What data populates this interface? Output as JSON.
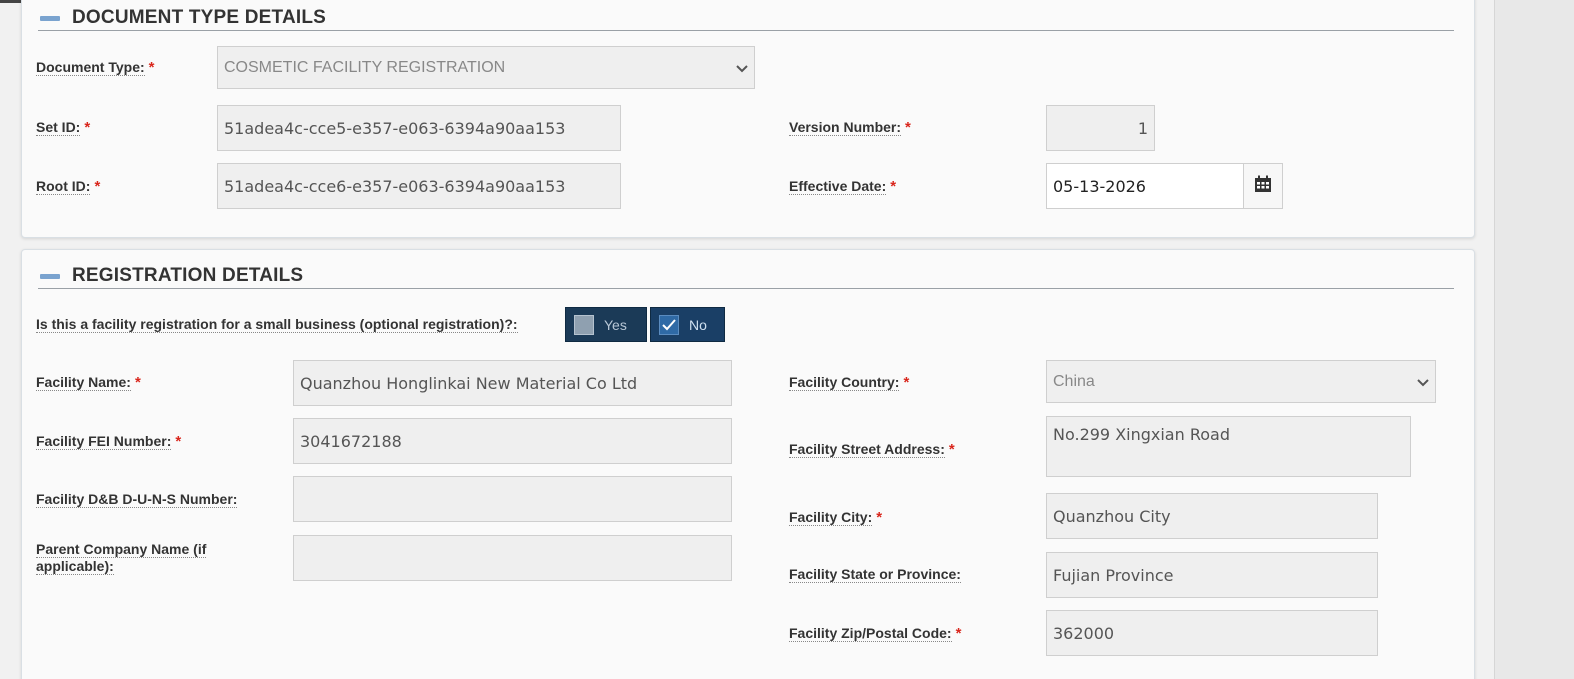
{
  "document_type_section": {
    "title": "DOCUMENT TYPE DETAILS",
    "document_type": {
      "label": "Document Type:",
      "value": "COSMETIC FACILITY REGISTRATION"
    },
    "set_id": {
      "label": "Set ID:",
      "value": "51adea4c-cce5-e357-e063-6394a90aa153"
    },
    "root_id": {
      "label": "Root ID:",
      "value": "51adea4c-cce6-e357-e063-6394a90aa153"
    },
    "version_number": {
      "label": "Version Number:",
      "value": "1"
    },
    "effective_date": {
      "label": "Effective Date:",
      "value": "05-13-2026"
    }
  },
  "registration_section": {
    "title": "REGISTRATION DETAILS",
    "small_business": {
      "label": "Is this a facility registration for a small business (optional registration)?:",
      "yes_label": "Yes",
      "no_label": "No",
      "selected": "No"
    },
    "facility_name": {
      "label": "Facility Name:",
      "value": "Quanzhou Honglinkai New Material Co Ltd"
    },
    "facility_fei": {
      "label": "Facility FEI Number:",
      "value": "3041672188"
    },
    "facility_duns": {
      "label": "Facility D&B D-U-N-S Number:",
      "value": ""
    },
    "parent_company": {
      "label": "Parent Company Name (if applicable):",
      "value": ""
    },
    "facility_country": {
      "label": "Facility Country:",
      "value": "China"
    },
    "facility_street": {
      "label": "Facility Street Address:",
      "value": "No.299 Xingxian Road"
    },
    "facility_city": {
      "label": "Facility City:",
      "value": "Quanzhou City"
    },
    "facility_state": {
      "label": "Facility State or Province:",
      "value": "Fujian Province"
    },
    "facility_zip": {
      "label": "Facility Zip/Postal Code:",
      "value": "362000"
    }
  },
  "required_marker": "*",
  "icons": {
    "collapse": "collapse-minus-icon",
    "calendar": "calendar-icon",
    "dropdown": "chevron-down-icon",
    "check": "checkmark-icon"
  },
  "colors": {
    "required": "#d9261c",
    "toggle_bg": "#1b3a57",
    "collapse_icon": "#7aa3cf"
  }
}
